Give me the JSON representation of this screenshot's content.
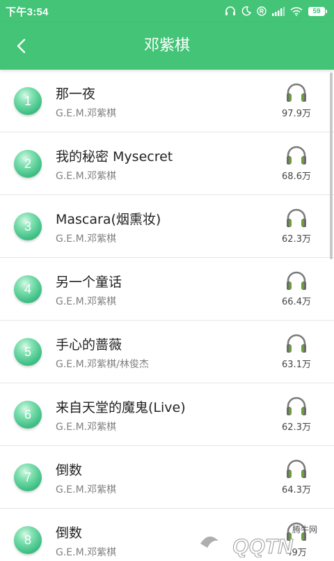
{
  "status_bar": {
    "time": "下午3:54",
    "battery": "59"
  },
  "header": {
    "title": "邓紫棋"
  },
  "songs": [
    {
      "rank": "1",
      "title": "那一夜",
      "artist": "G.E.M.邓紫棋",
      "plays": "97.9万"
    },
    {
      "rank": "2",
      "title": "我的秘密 Mysecret",
      "artist": "G.E.M.邓紫棋",
      "plays": "68.6万"
    },
    {
      "rank": "3",
      "title": "Mascara(烟熏妆)",
      "artist": "G.E.M.邓紫棋",
      "plays": "62.3万"
    },
    {
      "rank": "4",
      "title": "另一个童话",
      "artist": "G.E.M.邓紫棋",
      "plays": "66.4万"
    },
    {
      "rank": "5",
      "title": "手心的蔷薇",
      "artist": "G.E.M.邓紫棋/林俊杰",
      "plays": "63.1万"
    },
    {
      "rank": "6",
      "title": "来自天堂的魔鬼(Live)",
      "artist": "G.E.M.邓紫棋",
      "plays": "62.3万"
    },
    {
      "rank": "7",
      "title": "倒数",
      "artist": "G.E.M.邓紫棋",
      "plays": "64.3万"
    },
    {
      "rank": "8",
      "title": "倒数",
      "artist": "G.E.M.邓紫棋",
      "plays": "49万"
    }
  ],
  "watermark": {
    "text": "QQTN",
    "subtext": "腾牛网"
  },
  "colors": {
    "accent": "#43c477",
    "rank_ball": "#3fbf85",
    "headphone_pad": "#6b9e3a"
  }
}
